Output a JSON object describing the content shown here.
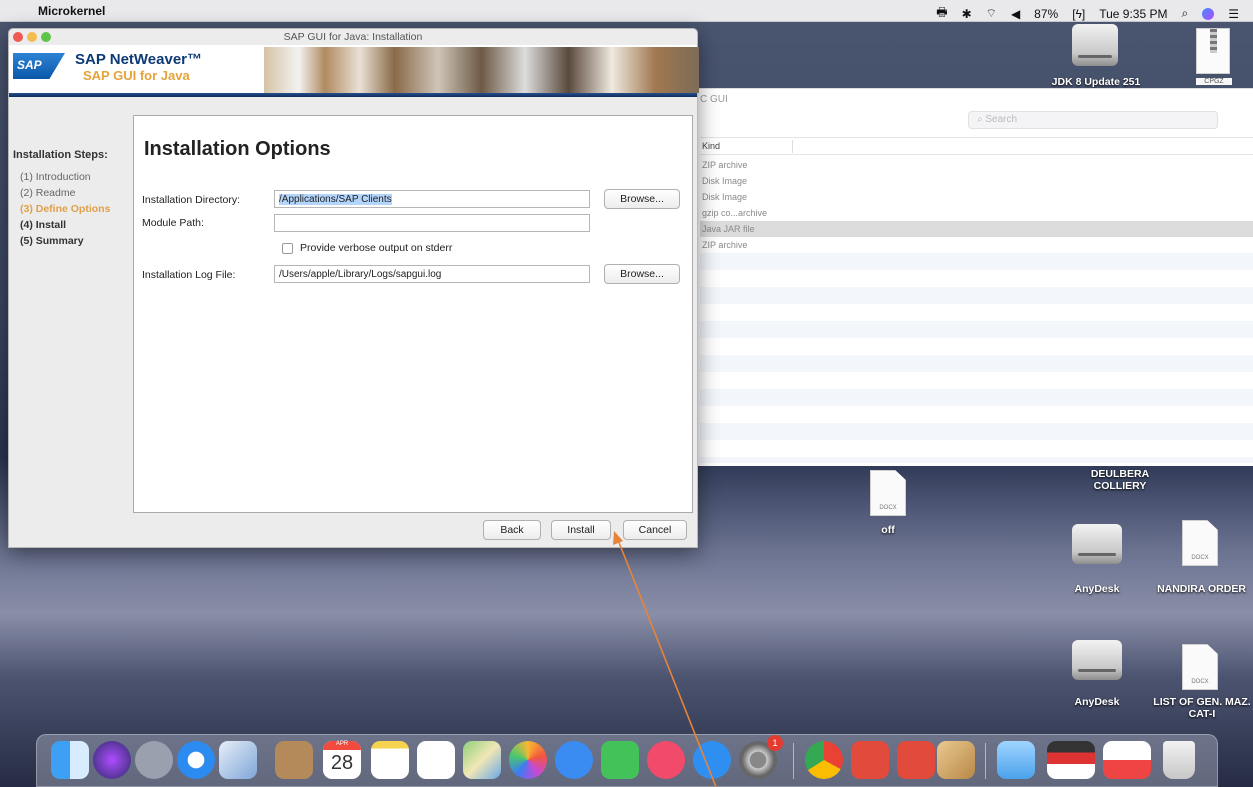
{
  "menubar": {
    "app_name": "Microkernel",
    "battery": "87%",
    "clock": "Tue 9:35 PM"
  },
  "installer": {
    "window_title": "SAP GUI for Java: Installation",
    "brand_logo": "SAP",
    "brand_line1": "SAP NetWeaver™",
    "brand_line2": "SAP GUI for Java",
    "steps_header": "Installation Steps:",
    "steps": [
      "(1) Introduction",
      "(2) Readme",
      "(3) Define Options",
      "(4) Install",
      "(5) Summary"
    ],
    "active_step": 2,
    "panel_title": "Installation Options",
    "install_dir_label": "Installation Directory:",
    "install_dir_value": "/Applications/SAP Clients",
    "module_path_label": "Module Path:",
    "module_path_value": "",
    "verbose_label": "Provide verbose output on stderr",
    "verbose_checked": false,
    "log_file_label": "Installation Log File:",
    "log_file_value": "/Users/apple/Library/Logs/sapgui.log",
    "browse_label": "Browse...",
    "back_label": "Back",
    "install_label": "Install",
    "cancel_label": "Cancel"
  },
  "finder": {
    "title_fragment": "C GUI",
    "search_placeholder": "Search",
    "kind_header": "Kind",
    "rows": [
      "ZIP archive",
      "Disk Image",
      "Disk Image",
      "gzip co...archive",
      "Java JAR file",
      "ZIP archive"
    ],
    "selected_row": 4
  },
  "desktop": {
    "items": [
      {
        "label": "JDK 8 Update 251",
        "icon": "drive-icon"
      },
      {
        "label": "CPGZ",
        "icon": "archive-icon"
      },
      {
        "label": "DEULBERA COLLIERY",
        "icon": "folder-label"
      },
      {
        "label": "off",
        "icon": "document-icon",
        "tag": "DOCX"
      },
      {
        "label": "AnyDesk",
        "icon": "drive-icon"
      },
      {
        "label": "NANDIRA ORDER",
        "icon": "document-icon",
        "tag": "DOCX"
      },
      {
        "label": "AnyDesk",
        "icon": "drive-icon"
      },
      {
        "label": "LIST OF GEN. MAZ. CAT-I",
        "icon": "document-icon",
        "tag": "DOCX"
      }
    ]
  },
  "dock": {
    "calendar_day": "28",
    "calendar_month": "APR",
    "badge": "1"
  },
  "colors": {
    "annotation_arrow": "#e8833a",
    "active_step": "#e0a04a"
  }
}
